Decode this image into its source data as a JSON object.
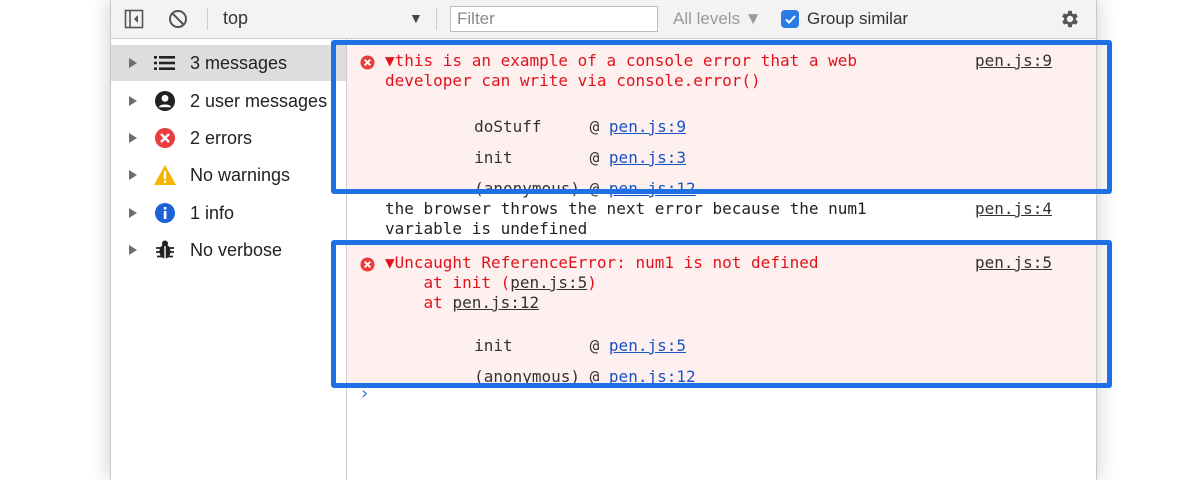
{
  "toolbar": {
    "context": "top",
    "filter_placeholder": "Filter",
    "levels_label": "All levels ▼",
    "group_similar_label": "Group similar",
    "context_caret": "▼"
  },
  "sidebar": {
    "items": [
      {
        "label": "3 messages",
        "icon": "list-icon",
        "selected": true
      },
      {
        "label": "2 user messages",
        "icon": "user-icon",
        "selected": false
      },
      {
        "label": "2 errors",
        "icon": "error-icon",
        "selected": false
      },
      {
        "label": "No warnings",
        "icon": "warning-icon",
        "selected": false
      },
      {
        "label": "1 info",
        "icon": "info-icon",
        "selected": false
      },
      {
        "label": "No verbose",
        "icon": "bug-icon",
        "selected": false
      }
    ]
  },
  "console": {
    "error1": {
      "text": "▼this is an example of a console error that a web\ndeveloper can write via console.error()",
      "source": "pen.js:9",
      "frames": [
        {
          "fn": "doStuff     @ ",
          "link": "pen.js:9"
        },
        {
          "fn": "init        @ ",
          "link": "pen.js:3"
        },
        {
          "fn": "(anonymous) @ ",
          "link": "pen.js:12"
        }
      ]
    },
    "log1": {
      "text": "the browser throws the next error because the num1\nvariable is undefined",
      "source": "pen.js:4"
    },
    "error2": {
      "text": "▼Uncaught ReferenceError: num1 is not defined",
      "stack_line1_prefix": "    at init (",
      "stack_line1_link": "pen.js:5",
      "stack_line1_suffix": ")",
      "stack_line2_prefix": "    at ",
      "stack_line2_link": "pen.js:12",
      "source": "pen.js:5",
      "frames": [
        {
          "fn": "init        @ ",
          "link": "pen.js:5"
        },
        {
          "fn": "(anonymous) @ ",
          "link": "pen.js:12"
        }
      ]
    },
    "prompt": "›"
  },
  "colors": {
    "error_red": "#e0131b",
    "link_blue": "#1a53c4",
    "highlight_blue": "#1f6fe5",
    "error_bg": "#fff0f0",
    "accent_blue": "#2a7be4"
  }
}
